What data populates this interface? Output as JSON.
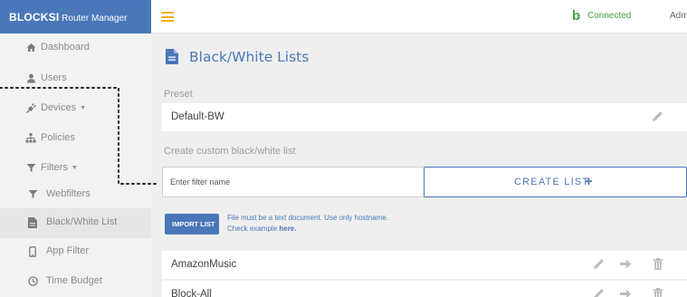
{
  "sidebar": {
    "brand_strong": "BLOCKSI",
    "brand_light": " Router Manager",
    "items": [
      {
        "label": "Dashboard",
        "icon": "home-icon"
      },
      {
        "label": "Users",
        "icon": "user-icon"
      },
      {
        "label": "Devices",
        "icon": "plug-icon"
      },
      {
        "label": "Policies",
        "icon": "sitemap-icon"
      },
      {
        "label": "Filters",
        "icon": "filter-icon"
      },
      {
        "label": "Webfilters",
        "icon": "filter-icon"
      },
      {
        "label": "Black/White List",
        "icon": "document-icon"
      },
      {
        "label": "App Filter",
        "icon": "mobile-icon"
      },
      {
        "label": "Time Budget",
        "icon": "clock-icon"
      }
    ],
    "caret": "▼"
  },
  "topbar": {
    "status_icon": "b",
    "status": "Connected",
    "user": "Adm"
  },
  "main": {
    "title": "Black/White Lists",
    "preset_label": "Preset",
    "preset_name": "Default-BW",
    "custom_label": "Create custom black/white list",
    "filter_placeholder": "Enter filter name",
    "create_button": "CREATE LIST",
    "create_plus": "+",
    "import_button": "IMPORT LIST",
    "import_note_line1": "File must be a text document. Use only hostname.",
    "import_note_line2": "Check example ",
    "import_note_link": "here.",
    "lists": [
      {
        "name": "AmazonMusic"
      },
      {
        "name": "Block-All"
      }
    ]
  },
  "colors": {
    "accent": "#4a77b9",
    "hamburger": "#f3b01c",
    "connected": "#43a047",
    "sidebar_bg": "#f2f2f2",
    "content_bg": "#efefef"
  },
  "icons": {
    "menu": "hamburger-icon",
    "edit": "pencil-icon",
    "move": "arrow-right-icon",
    "delete": "trash-icon",
    "title": "document-icon",
    "status": "blocksi-b-icon"
  }
}
